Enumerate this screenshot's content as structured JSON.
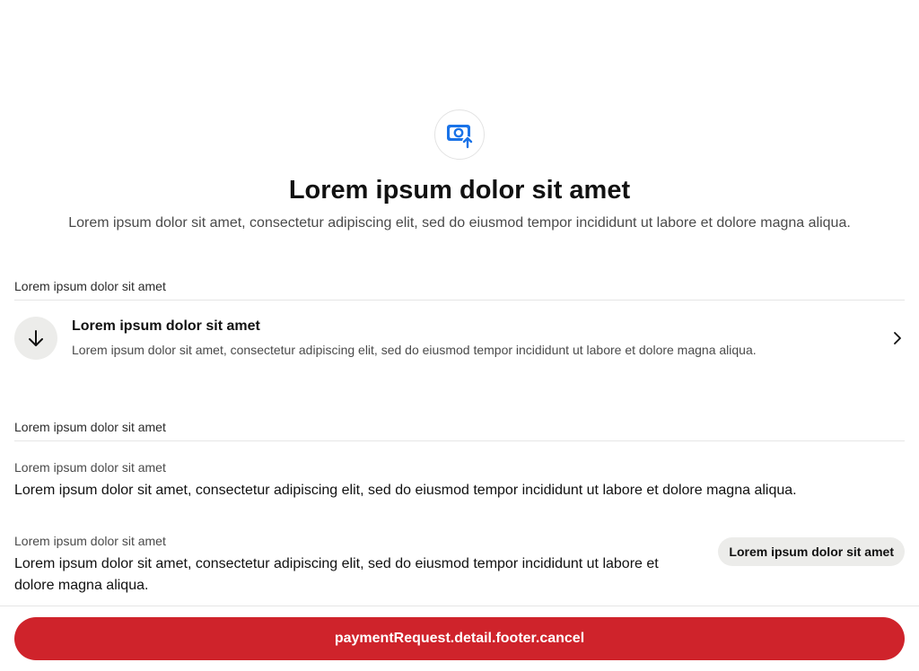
{
  "colors": {
    "accent_blue": "#1a73e8",
    "danger": "#cf232b",
    "chip_bg": "#ececea",
    "divider": "#e6e6e6"
  },
  "hero": {
    "icon": "camera-upload-icon",
    "title": "Lorem ipsum dolor sit amet",
    "subtitle": "Lorem ipsum dolor sit amet, consectetur adipiscing elit, sed do eiusmod tempor incididunt ut labore et dolore magna aliqua."
  },
  "section_one": {
    "label": "Lorem ipsum dolor sit amet",
    "action": {
      "icon": "arrow-down-icon",
      "title": "Lorem ipsum dolor sit amet",
      "description": "Lorem ipsum dolor sit amet, consectetur adipiscing elit, sed do eiusmod tempor incididunt ut labore et dolore magna aliqua.",
      "chevron": "chevron-right-icon"
    }
  },
  "section_two": {
    "label": "Lorem ipsum dolor sit amet",
    "details": [
      {
        "label": "Lorem ipsum dolor sit amet",
        "value": "Lorem ipsum dolor sit amet, consectetur adipiscing elit, sed do eiusmod tempor incididunt ut labore et dolore magna aliqua."
      },
      {
        "label": "Lorem ipsum dolor sit amet",
        "value_line1": "Lorem ipsum dolor sit amet, consectetur adipiscing elit, sed do eiusmod tempor incididunt ut labore et",
        "value_line2": "dolore magna aliqua.",
        "button_label": "Lorem ipsum dolor sit amet"
      }
    ]
  },
  "footer": {
    "cancel_label": "paymentRequest.detail.footer.cancel"
  }
}
